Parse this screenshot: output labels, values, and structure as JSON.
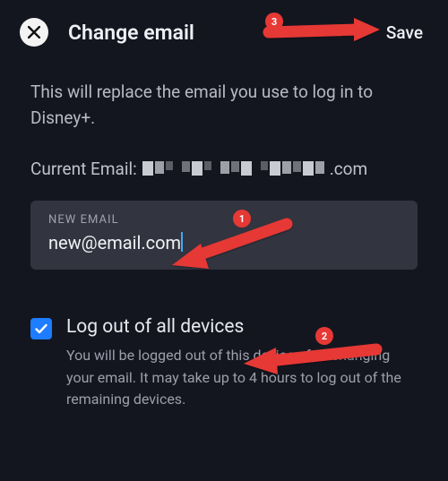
{
  "header": {
    "title": "Change email",
    "save": "Save"
  },
  "description": "This will replace the email you use to log in to Disney+.",
  "currentEmailLabel": "Current Email:",
  "currentEmailSuffix": ".com",
  "newEmail": {
    "label": "NEW EMAIL",
    "value": "new@email.com"
  },
  "logout": {
    "title": "Log out of all devices",
    "desc": "You will be logged out of this device after changing your email. It may take up to 4 hours to log out of the remaining devices.",
    "checked": true
  },
  "annotations": {
    "b1": "1",
    "b2": "2",
    "b3": "3"
  }
}
